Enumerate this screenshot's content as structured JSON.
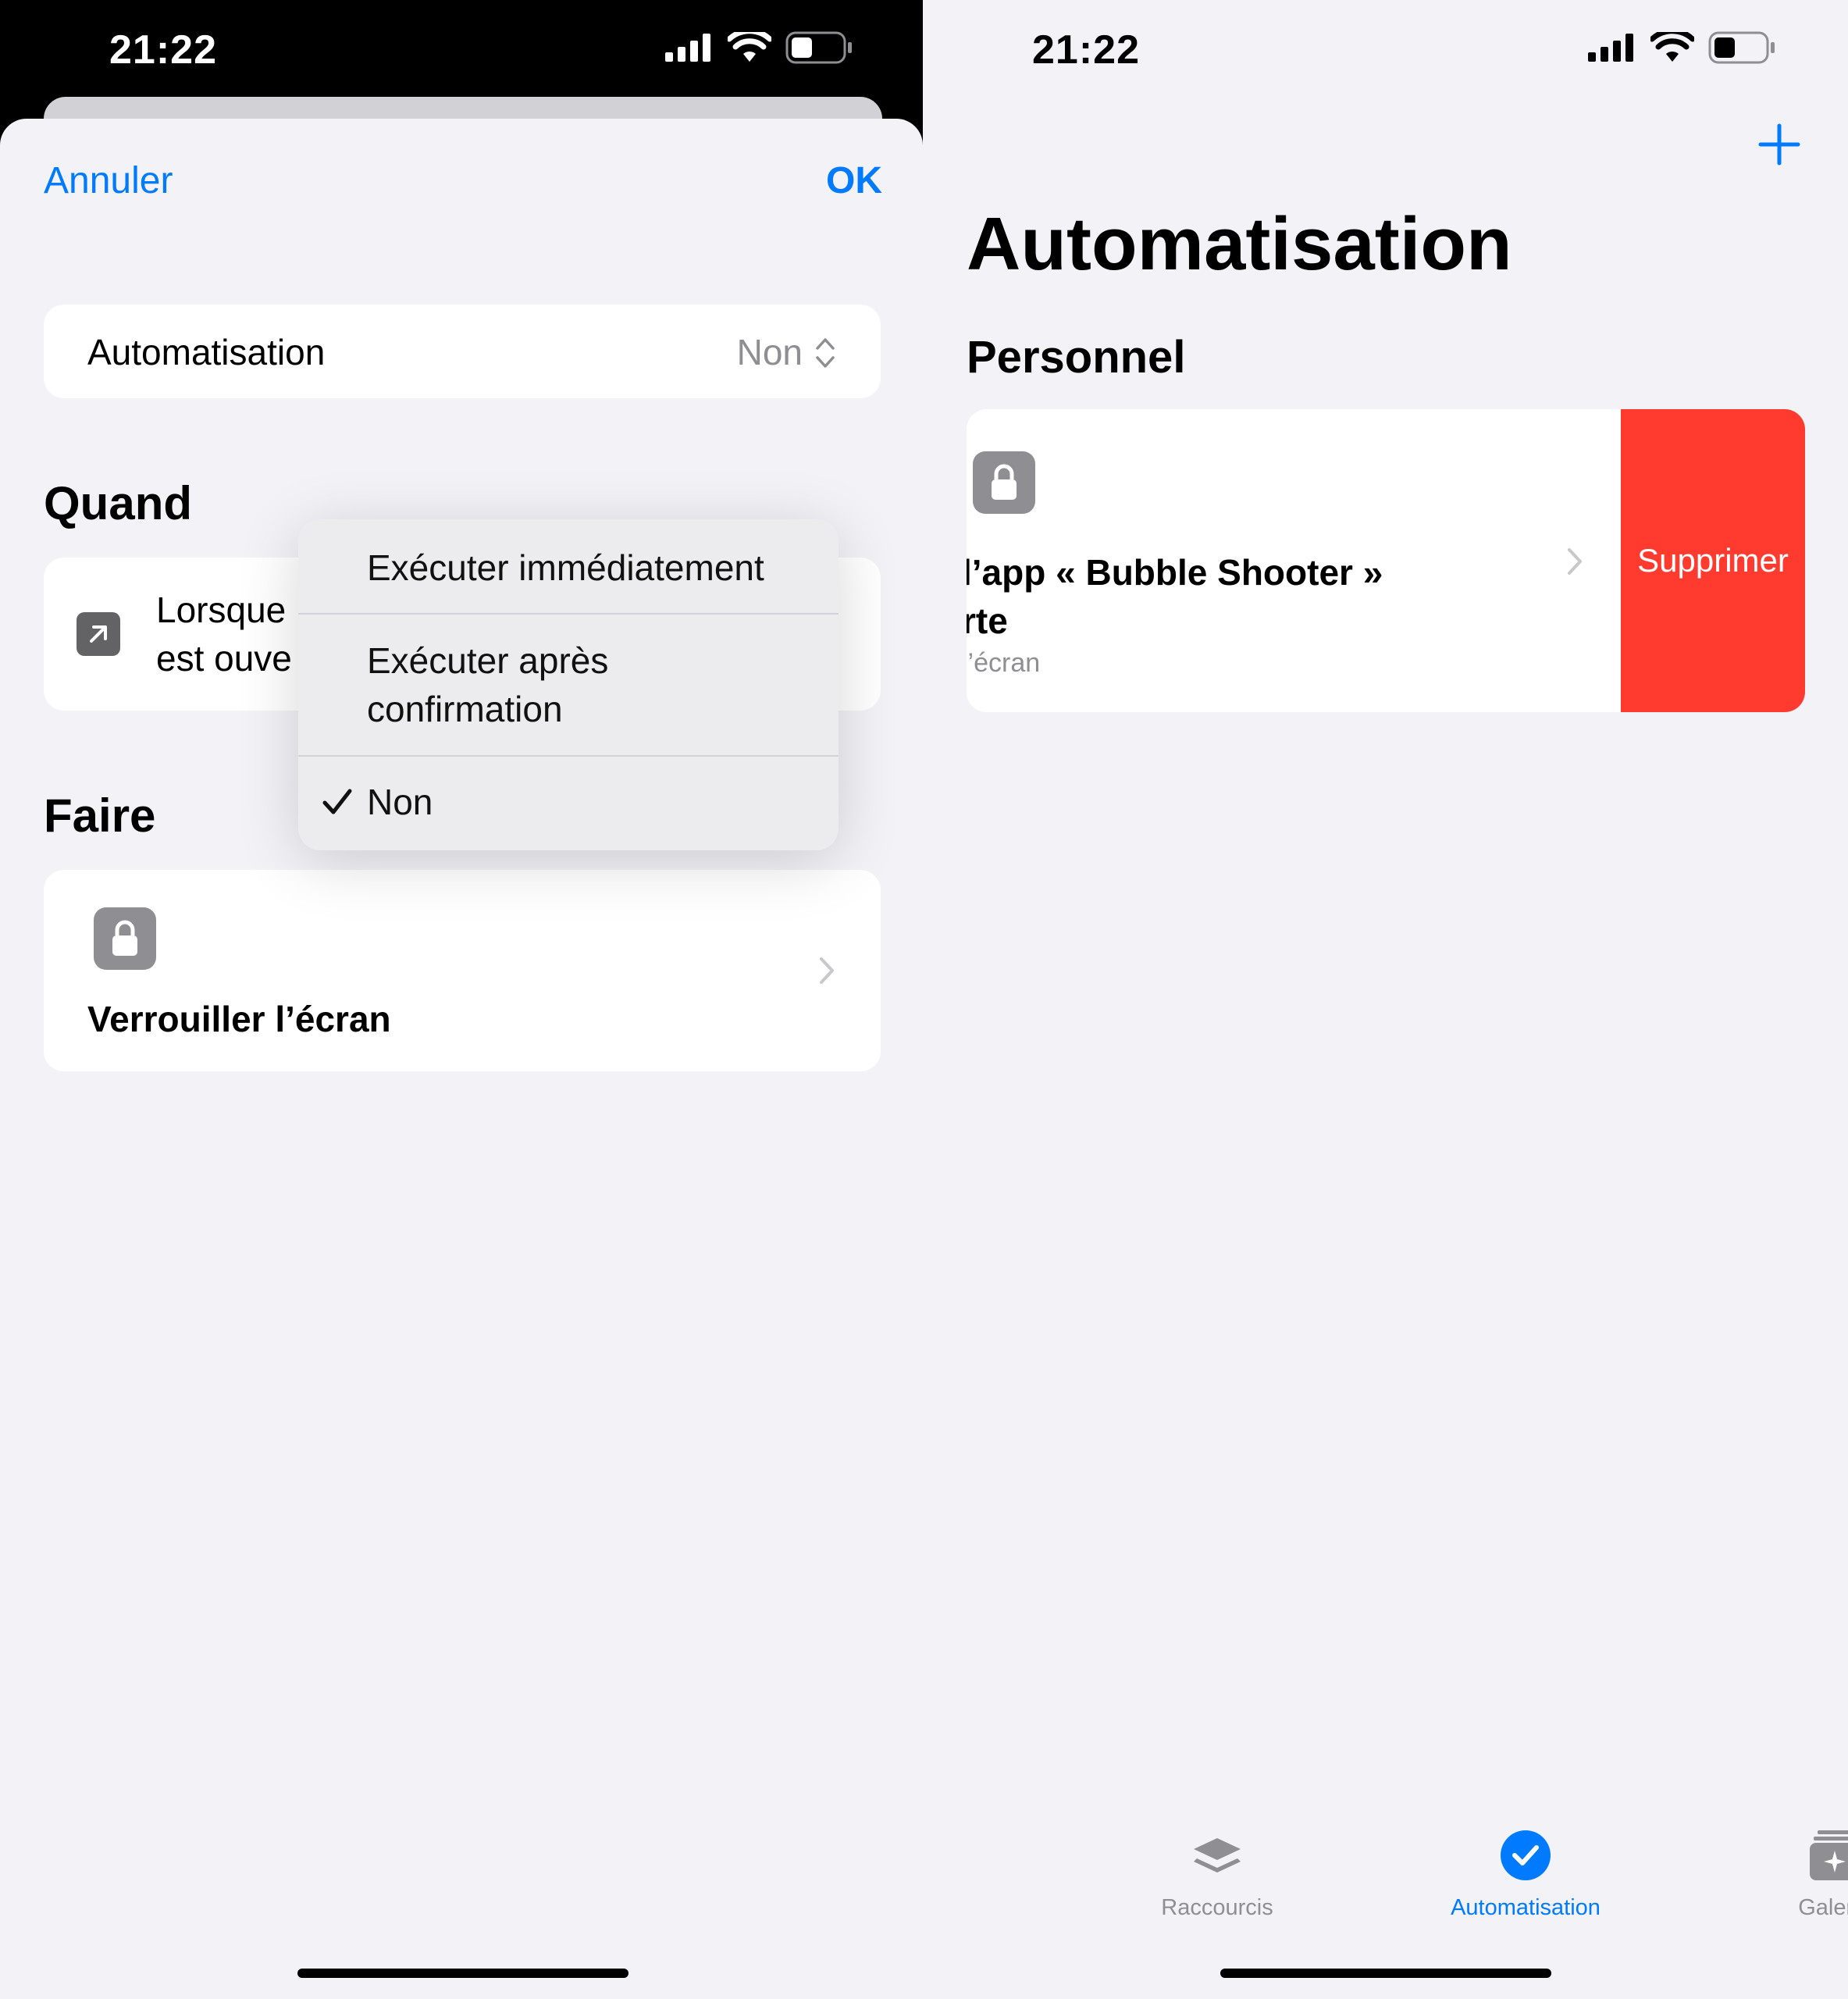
{
  "left": {
    "status_time": "21:22",
    "nav": {
      "cancel": "Annuler",
      "ok": "OK"
    },
    "automation_row": {
      "label": "Automatisation",
      "value": "Non"
    },
    "menu": [
      {
        "label": "Exécuter immédiatement",
        "checked": false
      },
      {
        "label": "Exécuter après\nconfirmation",
        "checked": false
      },
      {
        "label": "Non",
        "checked": true
      }
    ],
    "when": {
      "heading": "Quand",
      "trigger_text": "Lorsque\nest ouve"
    },
    "do": {
      "heading": "Faire",
      "action_title": "Verrouiller l’écran"
    }
  },
  "right": {
    "status_time": "21:22",
    "title": "Automatisation",
    "section": "Personnel",
    "item": {
      "title": "l’app « Bubble Shooter »\nrte",
      "subtitle": "l’écran"
    },
    "delete_label": "Supprimer",
    "tabs": [
      {
        "label": "Raccourcis",
        "icon": "layers-icon",
        "active": false
      },
      {
        "label": "Automatisation",
        "icon": "checkmark-circle-icon",
        "active": true
      },
      {
        "label": "Galerie",
        "icon": "gallery-sparkle-icon",
        "active": false
      }
    ]
  },
  "colors": {
    "accent": "#007aff",
    "delete": "#ff3b30",
    "gray_icon": "#8e8e93",
    "background": "#f2f2f7",
    "inactive_tab": "#8e8e93"
  }
}
